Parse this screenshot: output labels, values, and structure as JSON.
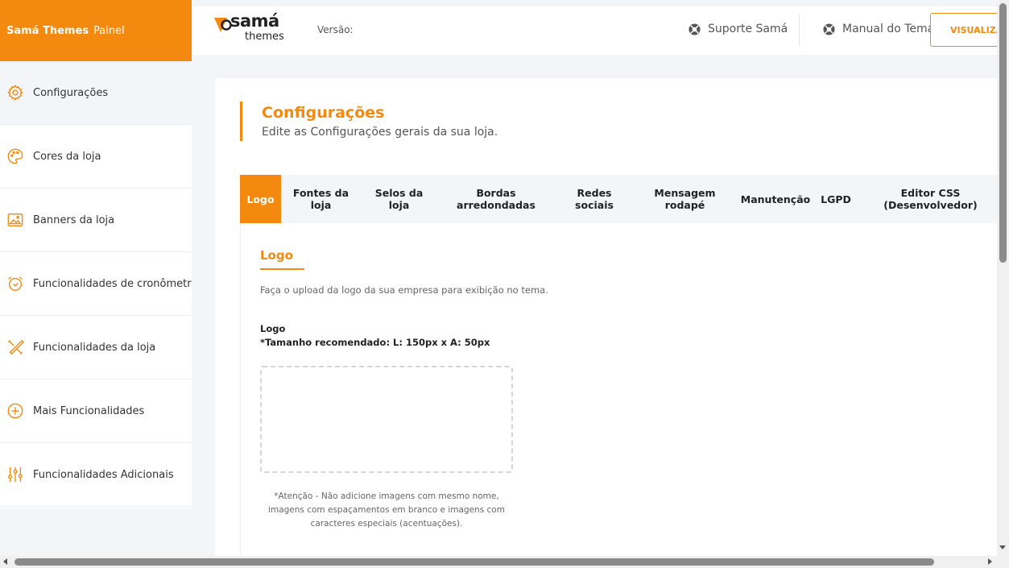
{
  "brand": {
    "name": "Samá Themes",
    "panel": "Painel",
    "accent": "#f4890f"
  },
  "sidebar": {
    "items": [
      {
        "label": "Configurações",
        "icon": "gear-icon"
      },
      {
        "label": "Cores da loja",
        "icon": "palette-icon"
      },
      {
        "label": "Banners da loja",
        "icon": "image-icon"
      },
      {
        "label": "Funcionalidades de cronômetro",
        "icon": "alarm-clock-icon"
      },
      {
        "label": "Funcionalidades da loja",
        "icon": "tools-icon"
      },
      {
        "label": "Mais Funcionalidades",
        "icon": "plus-circle-icon"
      },
      {
        "label": "Funcionalidades Adicionais",
        "icon": "sliders-icon"
      }
    ]
  },
  "header": {
    "logo_top": "samá",
    "logo_bottom": "themes",
    "version_label": "Versão:",
    "support_link": "Suporte Samá",
    "manual_link": "Manual do Tema",
    "preview_button": "VISUALIZAR"
  },
  "page": {
    "title": "Configurações",
    "subtitle": "Edite as Configurações gerais da sua loja."
  },
  "tabs": [
    {
      "label": "Logo",
      "active": true
    },
    {
      "label": "Fontes da loja",
      "active": false
    },
    {
      "label": "Selos da loja",
      "active": false
    },
    {
      "label": "Bordas arredondadas",
      "active": false
    },
    {
      "label": "Redes sociais",
      "active": false
    },
    {
      "label": "Mensagem rodapé",
      "active": false
    },
    {
      "label": "Manutenção",
      "active": false
    },
    {
      "label": "LGPD",
      "active": false
    },
    {
      "label": "Editor CSS (Desenvolvedor)",
      "active": false
    }
  ],
  "logo_section": {
    "title": "Logo",
    "description": "Faça o upload da logo da sua empresa para exibição no tema.",
    "field_label": "Logo",
    "size_hint": "*Tamanho recomendado: L: 150px x A: 50px",
    "warning": "*Atenção - Não adicione imagens com mesmo nome, imagens com espaçamentos em branco e imagens com caracteres especiais (acentuações)."
  }
}
